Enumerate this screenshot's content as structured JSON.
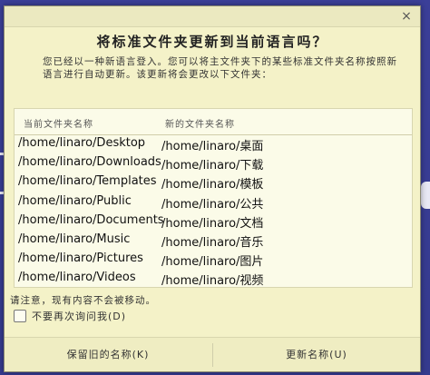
{
  "dialog": {
    "title": "将标准文件夹更新到当前语言吗？",
    "description": "您已经以一种新语言登入。您可以将主文件夹下的某些标准文件夹名称按照新语言进行自动更新。该更新将会更改以下文件夹：",
    "close_icon": "×"
  },
  "table": {
    "headers": {
      "current": "当前文件夹名称",
      "new": "新的文件夹名称"
    },
    "rows": [
      {
        "current": "/home/linaro/Desktop",
        "new": "/home/linaro/桌面"
      },
      {
        "current": "/home/linaro/Downloads",
        "new": "/home/linaro/下载"
      },
      {
        "current": "/home/linaro/Templates",
        "new": "/home/linaro/模板"
      },
      {
        "current": "/home/linaro/Public",
        "new": "/home/linaro/公共"
      },
      {
        "current": "/home/linaro/Documents",
        "new": "/home/linaro/文档"
      },
      {
        "current": "/home/linaro/Music",
        "new": "/home/linaro/音乐"
      },
      {
        "current": "/home/linaro/Pictures",
        "new": "/home/linaro/图片"
      },
      {
        "current": "/home/linaro/Videos",
        "new": "/home/linaro/视频"
      }
    ]
  },
  "notice": "请注意，现有内容不会被移动。",
  "checkbox": {
    "label": "不要再次询问我(D)",
    "checked": false
  },
  "buttons": {
    "keep": "保留旧的名称(K)",
    "update": "更新名称(U)"
  }
}
